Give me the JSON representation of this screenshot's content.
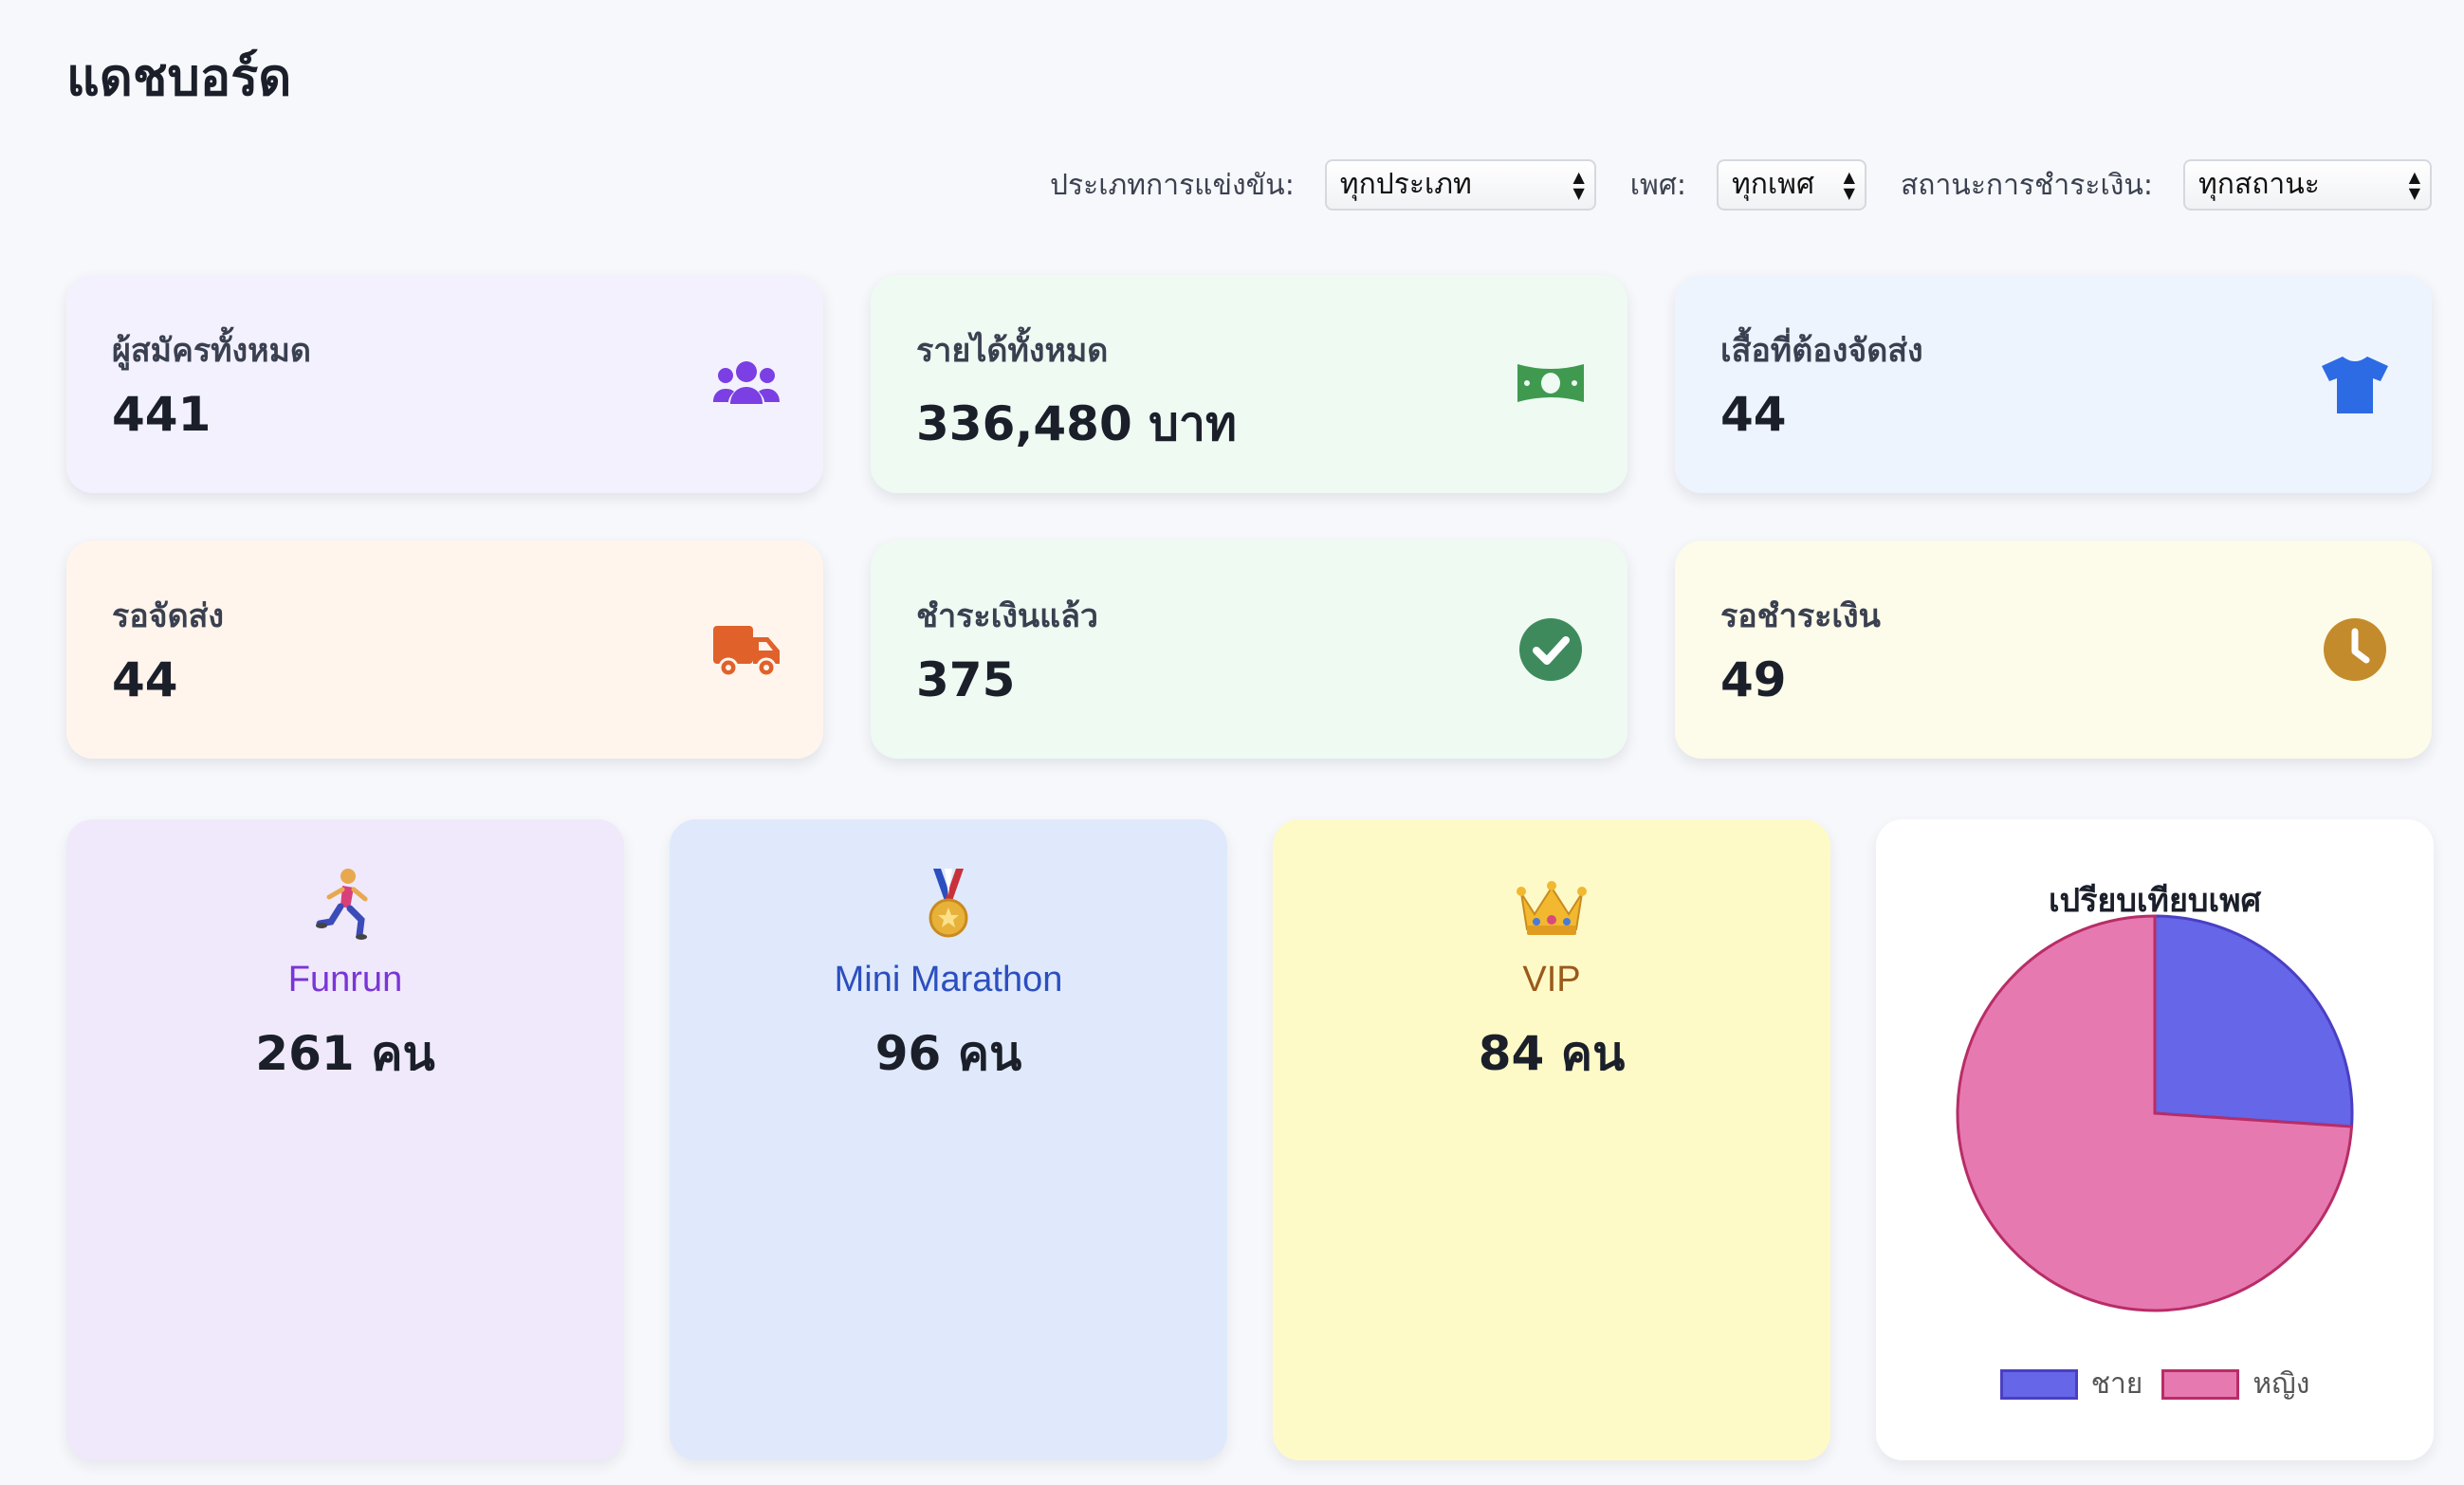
{
  "header": {
    "title": "แดชบอร์ด"
  },
  "filters": {
    "category_label": "ประเภทการแข่งขัน:",
    "category_value": "ทุกประเภท",
    "gender_label": "เพศ:",
    "gender_value": "ทุกเพศ",
    "payment_label": "สถานะการชำระเงิน:",
    "payment_value": "ทุกสถานะ"
  },
  "stats": [
    {
      "label": "ผู้สมัครทั้งหมด",
      "value": "441",
      "icon": "users-icon",
      "bg": "#f3f1fd",
      "color": "#7b3fe4"
    },
    {
      "label": "รายได้ทั้งหมด",
      "value": "336,480 บาท",
      "icon": "money-icon",
      "bg": "#eefaf2",
      "color": "#3f9a4f"
    },
    {
      "label": "เสื้อที่ต้องจัดส่ง",
      "value": "44",
      "icon": "tshirt-icon",
      "bg": "#eef4fe",
      "color": "#2d6be4"
    },
    {
      "label": "รอจัดส่ง",
      "value": "44",
      "icon": "truck-icon",
      "bg": "#fff5ec",
      "color": "#e0612a"
    },
    {
      "label": "ชำระเงินแล้ว",
      "value": "375",
      "icon": "check-circle-icon",
      "bg": "#eefaf2",
      "color": "#3e8a5c"
    },
    {
      "label": "รอชำระเงิน",
      "value": "49",
      "icon": "clock-icon",
      "bg": "#fdfbe9",
      "color": "#c38b2c"
    }
  ],
  "categories": [
    {
      "name": "Funrun",
      "count": "261 คน",
      "icon": "runner-icon",
      "bg": "#efe9fb",
      "color": "#7a35d6"
    },
    {
      "name": "Mini Marathon",
      "count": "96 คน",
      "icon": "medal-icon",
      "bg": "#dfe9fb",
      "color": "#2c4fbf"
    },
    {
      "name": "VIP",
      "count": "84 คน",
      "icon": "crown-icon",
      "bg": "#fefac8",
      "color": "#9a5a1a"
    }
  ],
  "chart_data": {
    "type": "pie",
    "title": "เปรียบเทียบเพศ",
    "series": [
      {
        "name": "ชาย",
        "value": 115,
        "color": "#6566e8",
        "border": "#4a3fc4"
      },
      {
        "name": "หญิง",
        "value": 326,
        "color": "#e779b1",
        "border": "#b82d66"
      }
    ],
    "legend": "bottom"
  }
}
